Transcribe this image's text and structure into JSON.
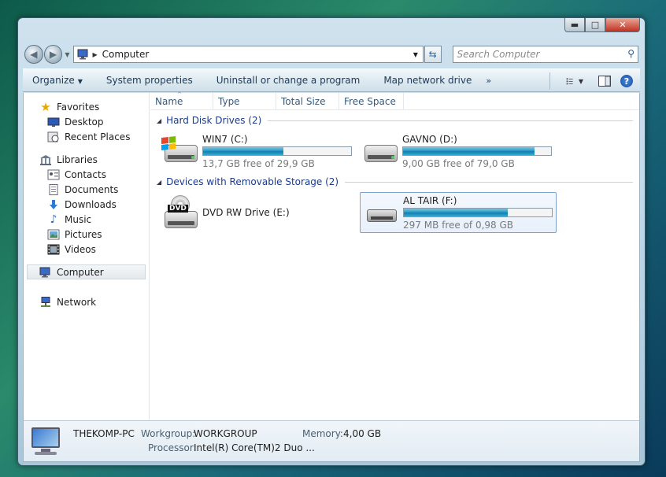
{
  "window": {
    "min_label": "▬",
    "max_label": "□",
    "close_label": "✕"
  },
  "navigation": {
    "address": "Computer",
    "search_placeholder": "Search Computer"
  },
  "toolbar": {
    "organize": "Organize",
    "system_properties": "System properties",
    "uninstall": "Uninstall or change a program",
    "map_drive": "Map network drive",
    "more": "»"
  },
  "sidebar": {
    "favorites": "Favorites",
    "favorites_items": [
      "Desktop",
      "Recent Places"
    ],
    "libraries": "Libraries",
    "libraries_items": [
      "Contacts",
      "Documents",
      "Downloads",
      "Music",
      "Pictures",
      "Videos"
    ],
    "computer": "Computer",
    "network": "Network"
  },
  "columns": [
    "Name",
    "Type",
    "Total Size",
    "Free Space"
  ],
  "groups": {
    "hard_disks": {
      "title": "Hard Disk Drives (2)",
      "drives": [
        {
          "name": "WIN7 (C:)",
          "free": "13,7 GB free of 29,9 GB",
          "used_fraction": 0.54
        },
        {
          "name": "GAVNO (D:)",
          "free": "9,00 GB free of 79,0 GB",
          "used_fraction": 0.89
        }
      ]
    },
    "removable": {
      "title": "Devices with Removable Storage (2)",
      "dvd": {
        "name": "DVD RW Drive (E:)",
        "badge": "DVD"
      },
      "usb": {
        "name": "AL TAIR (F:)",
        "free": "297 MB free of 0,98 GB",
        "used_fraction": 0.7
      }
    }
  },
  "details": {
    "pc_name": "THEKOMP-PC",
    "workgroup_label": "Workgroup:",
    "workgroup": "WORKGROUP",
    "memory_label": "Memory:",
    "memory": "4,00 GB",
    "processor_label": "Processor:",
    "processor": "Intel(R) Core(TM)2 Duo ..."
  }
}
